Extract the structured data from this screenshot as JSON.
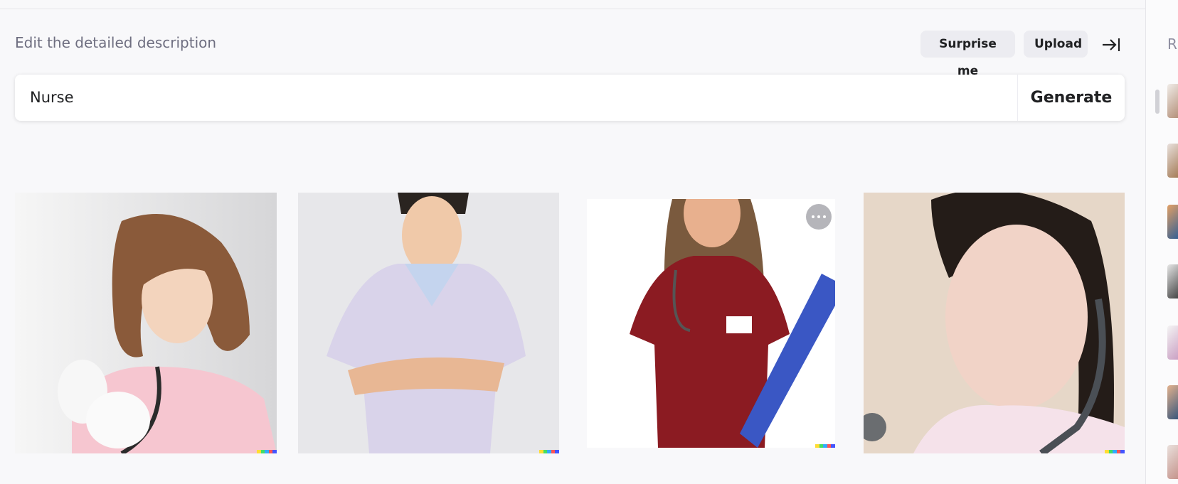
{
  "prompt": {
    "label": "Edit the detailed description",
    "value": "Nurse",
    "surprise_label": "Surprise me",
    "upload_label": "Upload",
    "generate_label": "Generate"
  },
  "icons": {
    "collapse": "arrow-right-to-line-icon",
    "more": "more-horizontal-icon"
  },
  "images": [
    {
      "subject": "nurse in pink uniform with stethoscope"
    },
    {
      "subject": "male nurse in lavender scrubs with crossed arms"
    },
    {
      "subject": "nurse in maroon scrubs holding blue clipboard"
    },
    {
      "subject": "smiling nurse with stethoscope, close-up"
    }
  ],
  "sidebar": {
    "header_initial": "R",
    "thumb_count": 7
  },
  "colors": {
    "background": "#f8f8fa",
    "pill": "#ececf1",
    "text": "#202123",
    "muted": "#6e6e80"
  }
}
